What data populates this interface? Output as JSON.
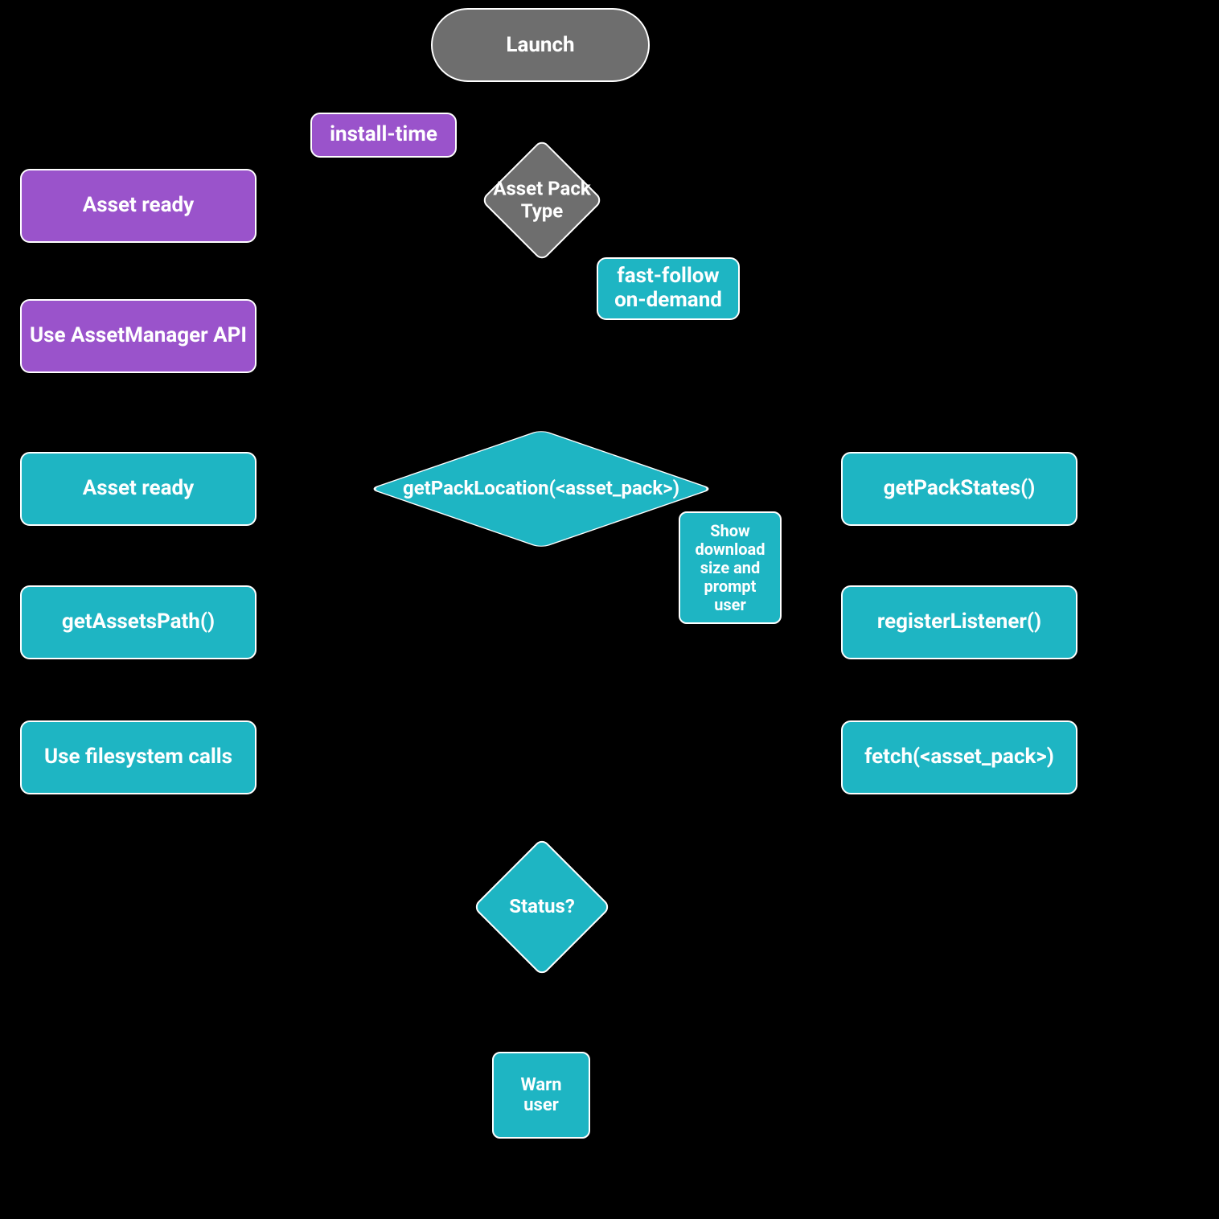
{
  "colors": {
    "teal": "#1eb5c3",
    "purple": "#9a53cb",
    "gray": "#6e6e6e"
  },
  "nodes": {
    "launch": "Launch",
    "install_time": "install-time",
    "asset_pack_type": "Asset Pack Type",
    "asset_ready_purple": "Asset ready",
    "fast_follow": "fast-follow on-demand",
    "use_assetmanager": "Use AssetManager API",
    "asset_ready_teal": "Asset ready",
    "get_pack_location": "getPackLocation(<asset_pack>)",
    "show_download": "Show download size and prompt user",
    "get_pack_states": "getPackStates()",
    "get_assets_path": "getAssetsPath()",
    "register_listener": "registerListener()",
    "use_filesystem": "Use filesystem calls",
    "fetch_pack": "fetch(<asset_pack>)",
    "status": "Status?",
    "warn_user": "Warn user"
  }
}
